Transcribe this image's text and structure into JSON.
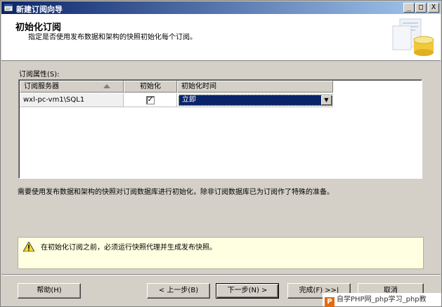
{
  "window": {
    "title": "新建订阅向导",
    "controls": {
      "minimize": "_",
      "maximize": "□",
      "close": "X"
    }
  },
  "header": {
    "title": "初始化订阅",
    "subtitle": "指定是否使用发布数据和架构的快照初始化每个订阅。"
  },
  "subscription_props": {
    "label": "订阅属性(S):",
    "columns": [
      "订阅服务器",
      "初始化",
      "初始化时间"
    ],
    "rows": [
      {
        "server": "wxl-pc-vm1\\SQL1",
        "initialize": true,
        "check_glyph": "✓",
        "init_time": "立即"
      }
    ]
  },
  "info_text": "需要使用发布数据和架构的快照对订阅数据库进行初始化，除非订阅数据库已为订阅作了特殊的准备。",
  "warning": {
    "icon": "warning-icon",
    "text": "在初始化订阅之前，必须运行快照代理并生成发布快照。"
  },
  "buttons": {
    "help": "帮助(H)",
    "back": "< 上一步(B)",
    "next": "下一步(N) >",
    "finish": "完成(F) >>|",
    "cancel": "取消"
  },
  "watermark": {
    "logo_letter": "P",
    "text": "自学PHP网_php学习_php教"
  },
  "colors": {
    "title_bar_start": "#0a246a",
    "title_bar_end": "#a6caf0",
    "dialog_bg": "#d4d0c8",
    "warning_bg": "#ffffe1",
    "selection": "#0a246a"
  }
}
